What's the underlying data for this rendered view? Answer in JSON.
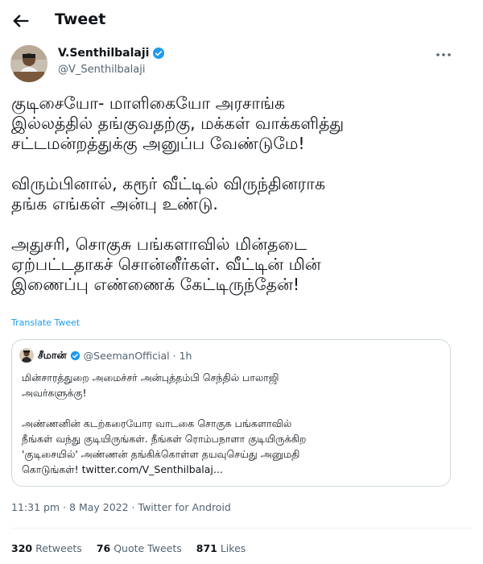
{
  "header": {
    "title": "Tweet",
    "back_icon": "arrow-left-icon"
  },
  "author": {
    "name": "V.Senthilbalaji",
    "handle": "@V_Senthilbalaji",
    "verified": true
  },
  "tweet": {
    "text": "குடிசையோ- மாளிகையோ அரசாங்க\nஇல்லத்தில் தங்குவதற்கு, மக்கள் வாக்களித்து\nசட்டமன்றத்துக்கு அனுப்ப வேண்டுமே!\n\nவிரும்பினால், கரூர் வீட்டில் விருந்தினராக\nதங்க எங்கள் அன்பு உண்டு.\n\nஅதுசரி, சொகுசு பங்களாவில் மின்தடை\nஏற்பட்டதாகச் சொன்னீர்கள். வீட்டின் மின்\nஇணைப்பு எண்ணைக் கேட்டிருந்தேன்!",
    "translate_label": "Translate Tweet"
  },
  "quote": {
    "name": "சீமான்",
    "handle": "@SeemanOfficial",
    "separator": "·",
    "time": "1h",
    "text": "மின்சாரத்துறை அமைச்சர் அன்புத்தம்பி செந்தில் பாலாஜி\nஅவர்களுக்கு!\n\nஅண்ணனின் கடற்கரையோர வாடகை சொகுசு பங்களாவில்\nநீங்கள் வந்து குடியிருங்கள். நீங்கள் ரொம்பநாளா குடியிருக்கிற\n'குடிசையில்' அண்ணன் தங்கிக்கொள்ள தயவுசெய்து அனுமதி\nகொடுங்கள்! twitter.com/V_Senthilbalaj..."
  },
  "meta": {
    "timestamp": "11:31 pm · 8 May 2022 · Twitter for Android"
  },
  "stats": {
    "retweets": "320",
    "retweets_label": "Retweets",
    "quote_tweets": "76",
    "quote_tweets_label": "Quote Tweets",
    "likes": "871",
    "likes_label": "Likes"
  },
  "colors": {
    "accent": "#1d9bf0",
    "secondary_text": "#536471",
    "border": "#cfd9de"
  }
}
